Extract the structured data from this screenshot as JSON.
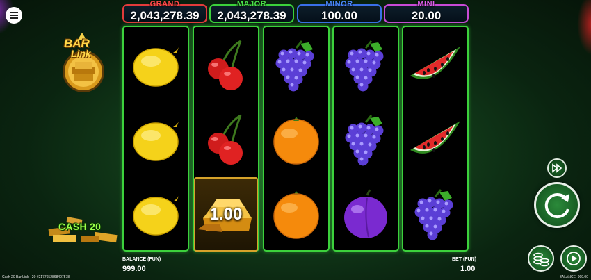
{
  "jackpots": {
    "grand": {
      "label": "GRAND",
      "value": "2,043,278.39",
      "color": "#e23b3b"
    },
    "major": {
      "label": "MAJOR",
      "value": "2,043,278.39",
      "color": "#3bd13b"
    },
    "minor": {
      "label": "MINOR",
      "value": "100.00",
      "color": "#3a6fe8"
    },
    "mini": {
      "label": "MINI",
      "value": "20.00",
      "color": "#c84ad6"
    }
  },
  "logo": {
    "text_line1": "BAR",
    "text_line2": "Link"
  },
  "cash_logo": {
    "text": "CASH 20"
  },
  "reels": [
    [
      "lemon",
      "lemon",
      "lemon"
    ],
    [
      "cherry",
      "cherry",
      "gold-bar"
    ],
    [
      "grapes",
      "orange",
      "orange"
    ],
    [
      "grapes",
      "grapes",
      "plum"
    ],
    [
      "watermelon",
      "watermelon",
      "grapes"
    ]
  ],
  "gold_bar_value": "1.00",
  "balance": {
    "label": "BALANCE (FUN)",
    "value": "999.00"
  },
  "bet": {
    "label": "BET (FUN)",
    "value": "1.00"
  },
  "footer": {
    "left": "Cash 20 Bar Link - 20 #2177652868407578",
    "right": "BALANCE: 999.00"
  },
  "colors": {
    "reel_border": "#3cd13c",
    "background": "#123c1a",
    "accent_gold": "#d6a22a"
  }
}
